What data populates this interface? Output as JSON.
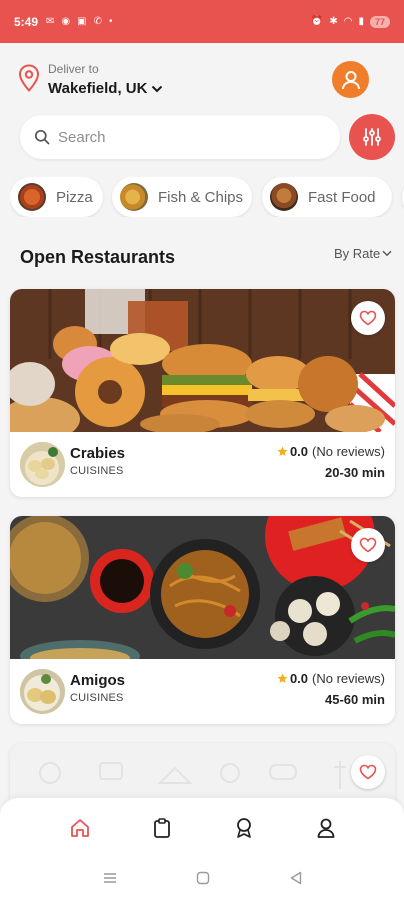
{
  "status_bar": {
    "time": "5:49",
    "battery": "77"
  },
  "header": {
    "deliver_label": "Deliver to",
    "city": "Wakefield, UK"
  },
  "search": {
    "placeholder": "Search"
  },
  "categories": [
    {
      "label": "Pizza"
    },
    {
      "label": "Fish & Chips"
    },
    {
      "label": "Fast Food"
    }
  ],
  "section": {
    "title": "Open Restaurants",
    "sort_label": "By Rate"
  },
  "restaurants": [
    {
      "name": "Crabies",
      "cuisine": "CUISINES",
      "rating": "0.0",
      "reviews": "(No reviews)",
      "eta": "20-30 min"
    },
    {
      "name": "Amigos",
      "cuisine": "CUISINES",
      "rating": "0.0",
      "reviews": "(No reviews)",
      "eta": "45-60 min"
    }
  ],
  "nav": {
    "items": [
      "home-icon",
      "orders-icon",
      "offers-icon",
      "profile-icon"
    ],
    "active": "home-icon"
  },
  "colors": {
    "accent": "#e9534f",
    "avatar": "#ef7d2a",
    "star": "#f2b01e"
  }
}
